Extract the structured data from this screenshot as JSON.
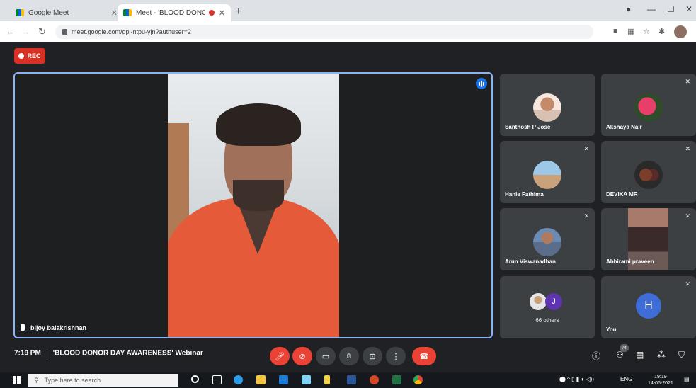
{
  "browser": {
    "tabs": [
      {
        "title": "Google Meet",
        "active": false
      },
      {
        "title": "Meet - 'BLOOD DONOR DA'",
        "active": true,
        "recording": true
      }
    ],
    "new_tab_icon": "plus-icon",
    "url": "meet.google.com/gpj-ntpu-yjn?authuser=2",
    "window_controls": [
      "minimize",
      "maximize",
      "close"
    ]
  },
  "recording": {
    "label": "REC",
    "color": "#d93025"
  },
  "main_speaker": {
    "name": "bijoy balakrishnan",
    "speaking": true
  },
  "participants": [
    {
      "name": "Santhosh P Jose",
      "muted": false
    },
    {
      "name": "Akshaya Nair",
      "muted": true
    },
    {
      "name": "Hanie Fathima",
      "muted": true
    },
    {
      "name": "DEVIKA MR",
      "muted": true
    },
    {
      "name": "Arun Viswanadhan",
      "muted": true
    },
    {
      "name": "Abhirami praveen",
      "muted": true
    },
    {
      "name": "You",
      "muted": true,
      "initial": "H"
    }
  ],
  "others": {
    "label": "66 others",
    "initial": "J"
  },
  "meeting": {
    "time": "7:19 PM",
    "title": "'BLOOD DONOR DAY AWARENESS' Webinar"
  },
  "participant_count": "74",
  "taskbar": {
    "search_placeholder": "Type here to search",
    "language": "ENG",
    "clock_time": "19:19",
    "clock_date": "14-06-2021"
  },
  "colors": {
    "accent": "#8ab4f8",
    "end_call": "#ea4335",
    "tile_bg": "#3c4043",
    "background": "#202124"
  }
}
